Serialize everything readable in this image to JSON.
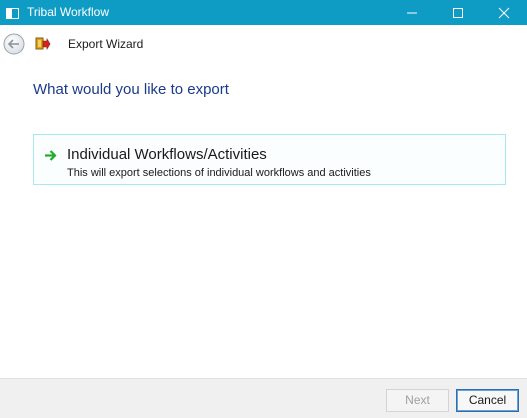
{
  "window": {
    "title": "Tribal Workflow",
    "icons": {
      "app": "window-app-icon",
      "minimize": "minimize-icon",
      "maximize": "maximize-icon",
      "close": "close-icon"
    }
  },
  "header": {
    "back_icon": "back-arrow-icon",
    "wizard_icon": "export-wizard-icon",
    "title": "Export Wizard"
  },
  "main": {
    "heading": "What would you like to export",
    "options": [
      {
        "icon": "green-arrow-right-icon",
        "title": "Individual Workflows/Activities",
        "description": "This will export selections of individual workflows and activities"
      }
    ]
  },
  "footer": {
    "next_label": "Next",
    "next_enabled": false,
    "cancel_label": "Cancel"
  },
  "colors": {
    "titlebar": "#0e9bc4",
    "heading": "#1b3a8a",
    "option_border": "#a9e8ee",
    "arrow_green": "#1fae2a",
    "cancel_border": "#2c6fb0"
  }
}
